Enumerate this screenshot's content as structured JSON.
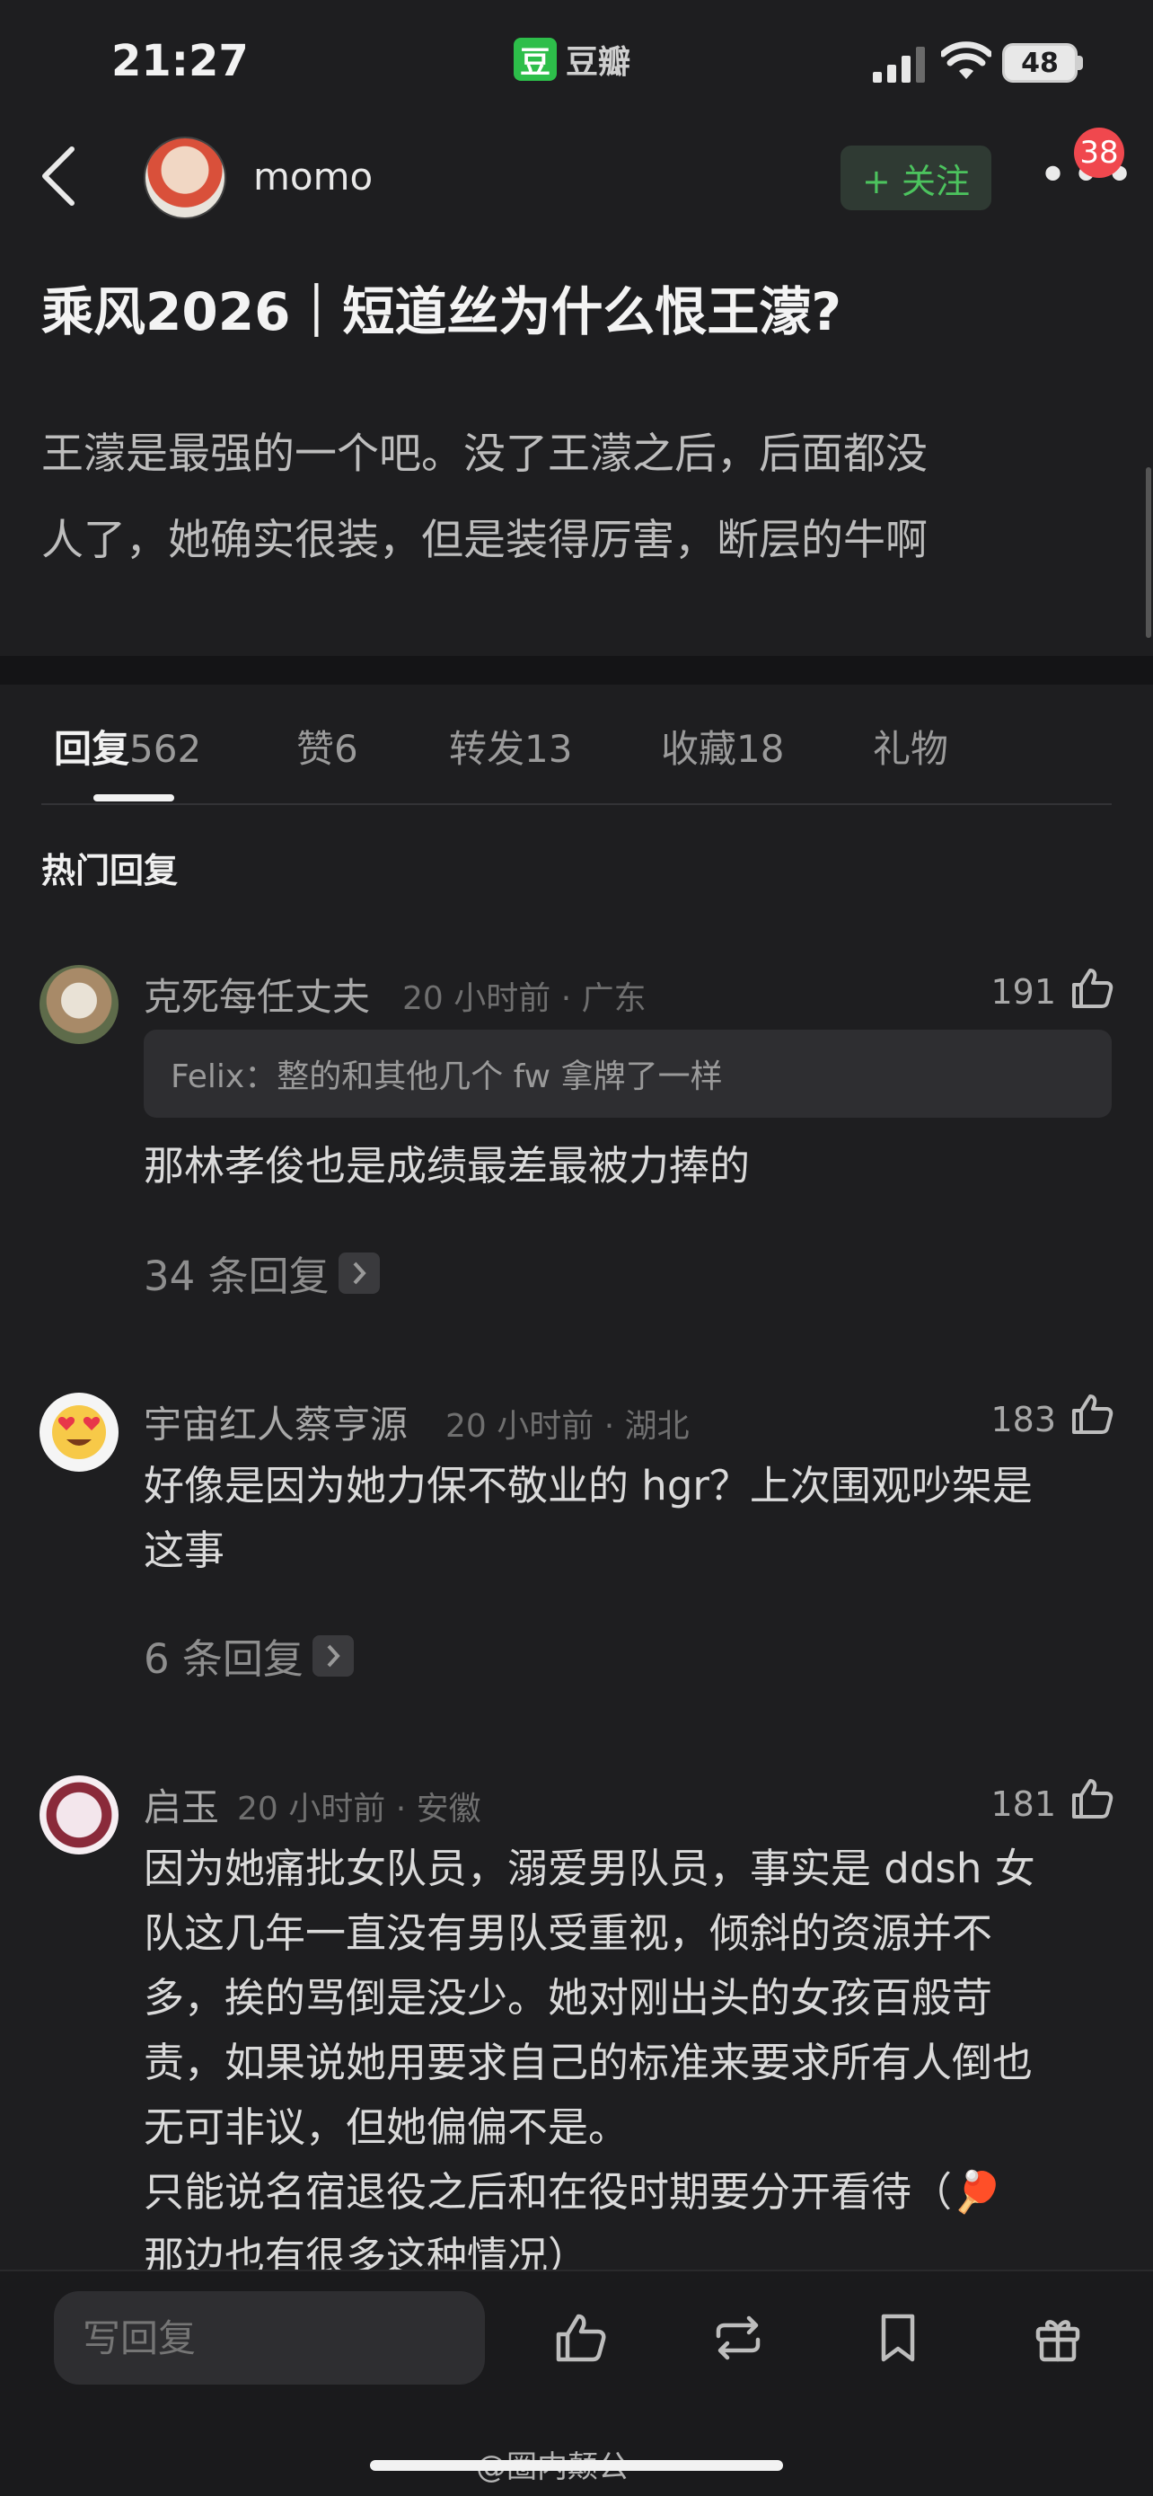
{
  "status_bar": {
    "time": "21:27",
    "app_logo_char": "豆",
    "app_name": "豆瓣",
    "battery": "48"
  },
  "header": {
    "author": "momo",
    "follow_label": "+ 关注",
    "more_label": "•••",
    "notification_count": "38"
  },
  "post": {
    "title": "乘风2026｜短道丝为什么恨王濛?",
    "body_lines": [
      "王濛是最强的一个吧。没了王濛之后，后面都没",
      "人了，她确实很装，但是装得厉害，断层的牛啊"
    ]
  },
  "tabs": [
    {
      "label": "回复",
      "count": "562",
      "active": true
    },
    {
      "label": "赞",
      "count": "6",
      "active": false
    },
    {
      "label": "转发",
      "count": "13",
      "active": false
    },
    {
      "label": "收藏",
      "count": "18",
      "active": false
    },
    {
      "label": "礼物",
      "count": "",
      "active": false
    }
  ],
  "section_title": "热门回复",
  "comments": [
    {
      "user": "克死每任丈夫",
      "meta": "20 小时前 · 广东",
      "likes": "191",
      "quote": "Felix：整的和其他几个 fw 拿牌了一样",
      "text_lines": [
        "那林孝俊也是成绩最差最被力捧的"
      ],
      "replies": "34 条回复"
    },
    {
      "user": "宇宙红人蔡亨源",
      "meta": "20 小时前 · 湖北",
      "likes": "183",
      "text_lines": [
        "好像是因为她力保不敬业的 hgr？上次围观吵架是",
        "这事"
      ],
      "replies": "6 条回复"
    },
    {
      "user": "启玉",
      "meta": "20 小时前 · 安徽",
      "likes": "181",
      "text_lines": [
        "因为她痛批女队员，溺爱男队员，事实是 ddsh 女",
        "队这几年一直没有男队受重视，倾斜的资源并不",
        "多，挨的骂倒是没少。她对刚出头的女孩百般苛",
        "责，如果说她用要求自己的标准来要求所有人倒也",
        "无可非议，但她偏偏不是。",
        "只能说名宿退役之后和在役时期要分开看待（🏓",
        "那边也有很多这种情况）"
      ]
    }
  ],
  "bottom_bar": {
    "reply_placeholder": "写回复"
  },
  "watermark": "@圈内颠公",
  "colors": {
    "background": "#1e1e20",
    "accent_green": "#4cc35e",
    "badge_red": "#f0484e"
  }
}
